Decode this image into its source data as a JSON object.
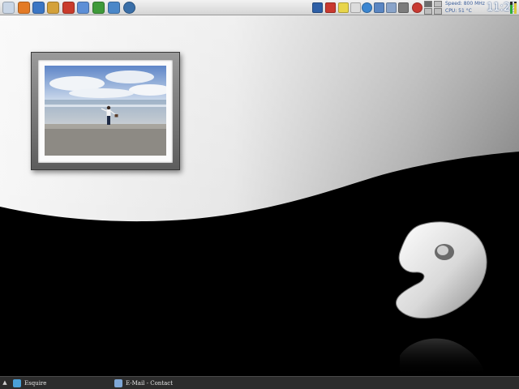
{
  "top_panel": {
    "launchers": [
      {
        "name": "main-menu-icon",
        "color": "#c9d6e6"
      },
      {
        "name": "firefox-icon",
        "color": "#e37a25"
      },
      {
        "name": "network-icon",
        "color": "#3b76c4"
      },
      {
        "name": "file-manager-icon",
        "color": "#d4a13a"
      },
      {
        "name": "mail-icon",
        "color": "#c93b2b"
      },
      {
        "name": "text-editor-icon",
        "color": "#5d8fd6"
      },
      {
        "name": "recycle-icon",
        "color": "#3f9a3a"
      },
      {
        "name": "settings-icon",
        "color": "#4a87c8"
      },
      {
        "name": "globe-icon",
        "color": "#3a6fa8"
      }
    ],
    "tray": [
      {
        "name": "monitor-icon",
        "color": "#2e5fa6"
      },
      {
        "name": "firewall-icon",
        "color": "#c9392f"
      },
      {
        "name": "notes-icon",
        "color": "#e8d54a"
      },
      {
        "name": "document-icon",
        "color": "#dcdcdc"
      },
      {
        "name": "messenger-icon",
        "color": "#3b86d1"
      },
      {
        "name": "display-icon",
        "color": "#5a86c2"
      },
      {
        "name": "screenshot-icon",
        "color": "#8aa4c9"
      },
      {
        "name": "tools-icon",
        "color": "#7c7c7c"
      },
      {
        "name": "update-icon",
        "color": "#c83a32"
      }
    ],
    "cpu_speed": "Speed: 800 MHz",
    "cpu_temp": "CPU: 51 °C",
    "clock": "11:22"
  },
  "taskbar": {
    "show_desktop_glyph": "▲",
    "tasks": [
      {
        "label": "Esquire",
        "icon_color": "#4aa0d8"
      },
      {
        "label": "E-Mail - Contact",
        "icon_color": "#7fa7d6"
      }
    ]
  },
  "colors": {
    "desktop_dark": "#000000",
    "desktop_light": "#ffffff",
    "panel_accent": "#3a5d9a"
  }
}
